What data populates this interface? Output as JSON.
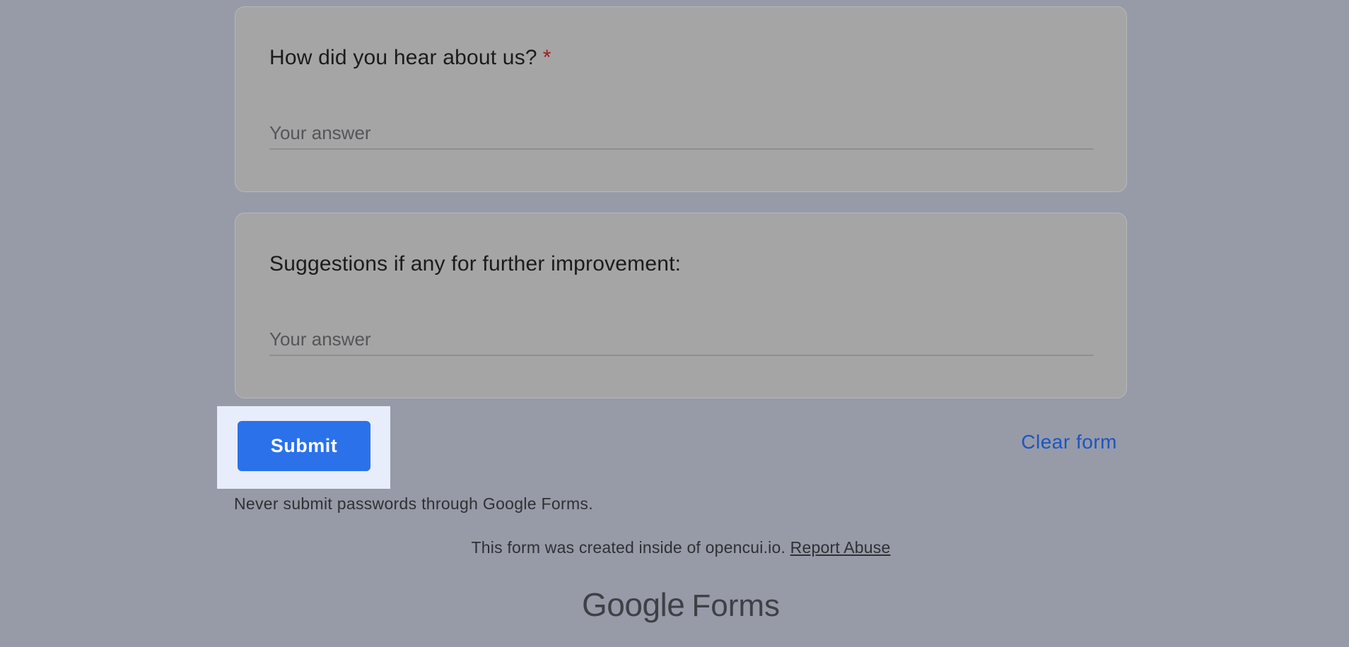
{
  "questions": [
    {
      "title": "How did you hear about us?",
      "required_marker": "*",
      "placeholder": "Your answer"
    },
    {
      "title": "Suggestions if any for further improvement:",
      "placeholder": "Your answer"
    }
  ],
  "actions": {
    "submit_label": "Submit",
    "clear_label": "Clear form"
  },
  "footer": {
    "warning": "Never submit passwords through Google Forms.",
    "created_text": "This form was created inside of opencui.io.",
    "report_link": "Report Abuse",
    "brand_google": "Google",
    "brand_forms": "Forms"
  },
  "colors": {
    "overlay_background": "#979ba8",
    "card_background": "#a5a5a6",
    "submit_button": "#2b71ea",
    "submit_highlight": "#e8edfb",
    "clear_link": "#1c55c4",
    "required_marker": "#9c1d1a"
  }
}
